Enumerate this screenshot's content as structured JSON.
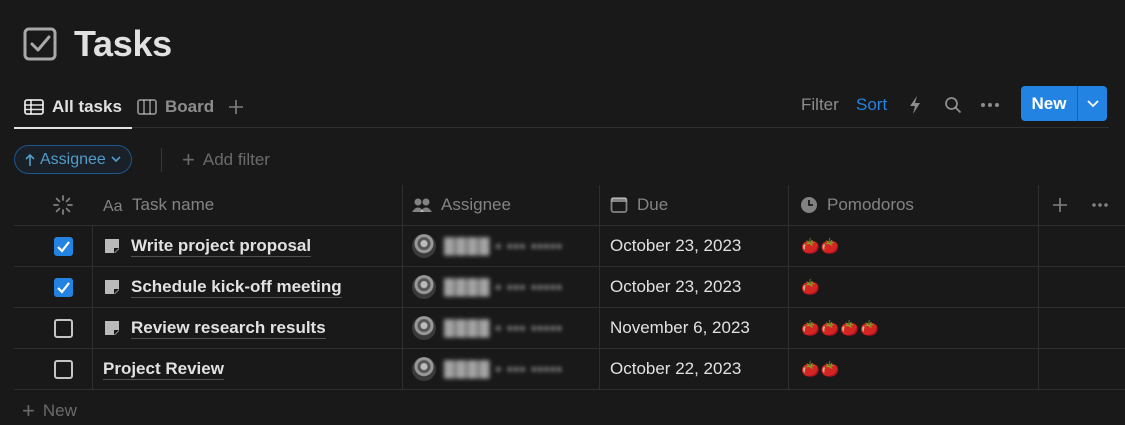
{
  "page": {
    "title": "Tasks",
    "icon": "checkbox-icon"
  },
  "views": {
    "tabs": [
      {
        "label": "All tasks",
        "icon": "table-icon",
        "active": true
      },
      {
        "label": "Board",
        "icon": "board-icon",
        "active": false
      }
    ]
  },
  "toolbar": {
    "filter_label": "Filter",
    "sort_label": "Sort",
    "new_label": "New"
  },
  "filters": {
    "sort_chip_label": "Assignee",
    "add_filter_label": "Add filter"
  },
  "table": {
    "columns": [
      {
        "label": "",
        "icon": "status-spinner-icon"
      },
      {
        "label": "Task name",
        "icon": "text-property-icon"
      },
      {
        "label": "Assignee",
        "icon": "people-icon"
      },
      {
        "label": "Due",
        "icon": "calendar-icon"
      },
      {
        "label": "Pomodoros",
        "icon": "clock-icon"
      }
    ],
    "rows": [
      {
        "done": true,
        "name": "Write project proposal",
        "has_page_icon": true,
        "assignee": "████ ▪ ▪▪▪ ▪▪▪▪▪",
        "due": "October 23, 2023",
        "pomodoros": "🍅🍅"
      },
      {
        "done": true,
        "name": "Schedule kick-off meeting",
        "has_page_icon": true,
        "assignee": "████ ▪ ▪▪▪ ▪▪▪▪▪",
        "due": "October 23, 2023",
        "pomodoros": "🍅"
      },
      {
        "done": false,
        "name": "Review research results",
        "has_page_icon": true,
        "assignee": "████ ▪ ▪▪▪ ▪▪▪▪▪",
        "due": "November 6, 2023",
        "pomodoros": "🍅🍅🍅🍅"
      },
      {
        "done": false,
        "name": "Project Review",
        "has_page_icon": false,
        "assignee": "████ ▪ ▪▪▪ ▪▪▪▪▪",
        "due": "October 22, 2023",
        "pomodoros": "🍅🍅"
      }
    ],
    "new_row_label": "New"
  },
  "colors": {
    "accent": "#2383e2",
    "background": "#191919"
  }
}
